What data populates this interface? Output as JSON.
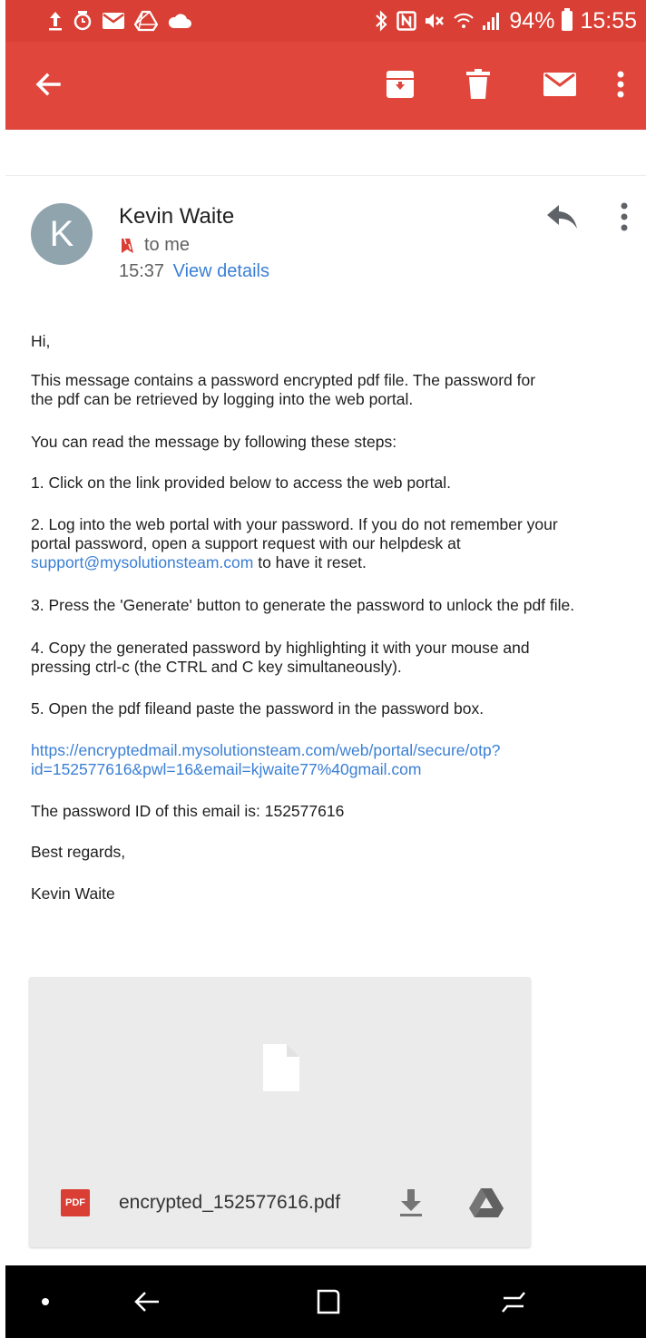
{
  "status_bar": {
    "battery": "94%",
    "time": "15:55",
    "icons_left": [
      "upload-icon",
      "alarm-icon",
      "gmail-icon",
      "drive-icon",
      "cloud-icon"
    ],
    "icons_right": [
      "bluetooth-icon",
      "nfc-icon",
      "mute-icon",
      "wifi-icon",
      "signal-icon",
      "battery-icon"
    ]
  },
  "app_bar": {
    "back_icon": "arrow-left-icon",
    "actions": [
      "archive-icon",
      "delete-icon",
      "mail-icon",
      "more-vert-icon"
    ],
    "color": "#e0463b"
  },
  "message": {
    "avatar_initial": "K",
    "sender": "Kevin Waite",
    "recipient_label": "to me",
    "time": "15:37",
    "view_details": "View details"
  },
  "body": {
    "greeting": "Hi,",
    "intro_line1": "This message contains a password encrypted pdf file. The password for",
    "intro_line2": "the pdf can be retrieved by logging into the web portal.",
    "steps_intro": "You can read the message by following these steps:",
    "step1": "1. Click on the link provided below to access the web portal.",
    "step2_line1": "2. Log into the web portal with your password. If you do not remember your",
    "step2_line2": "portal password, open a support request with our helpdesk at",
    "step2_email": "support@mysolutionsteam.com",
    "step2_tail": " to have it reset.",
    "step3": "3. Press the 'Generate' button to generate the password to unlock the pdf file.",
    "step4_line1": "4. Copy the generated password by highlighting it with your mouse and",
    "step4_line2": "pressing ctrl-c (the CTRL and C key simultaneously).",
    "step5": "5. Open the pdf fileand paste the password in the password box.",
    "link_line1": "https://encryptedmail.mysolutionsteam.com/web/portal/secure/otp?",
    "link_line2": "id=152577616&pwl=16&email=kjwaite77%40gmail.com",
    "password_id": "The password ID of this email is: 152577616",
    "closing": "Best regards,",
    "signature": "Kevin Waite"
  },
  "attachment": {
    "badge": "PDF",
    "filename": "encrypted_152577616.pdf"
  },
  "nav_bar": {
    "icons": [
      "dot-icon",
      "back-icon",
      "recents-icon",
      "switch-icon"
    ]
  }
}
